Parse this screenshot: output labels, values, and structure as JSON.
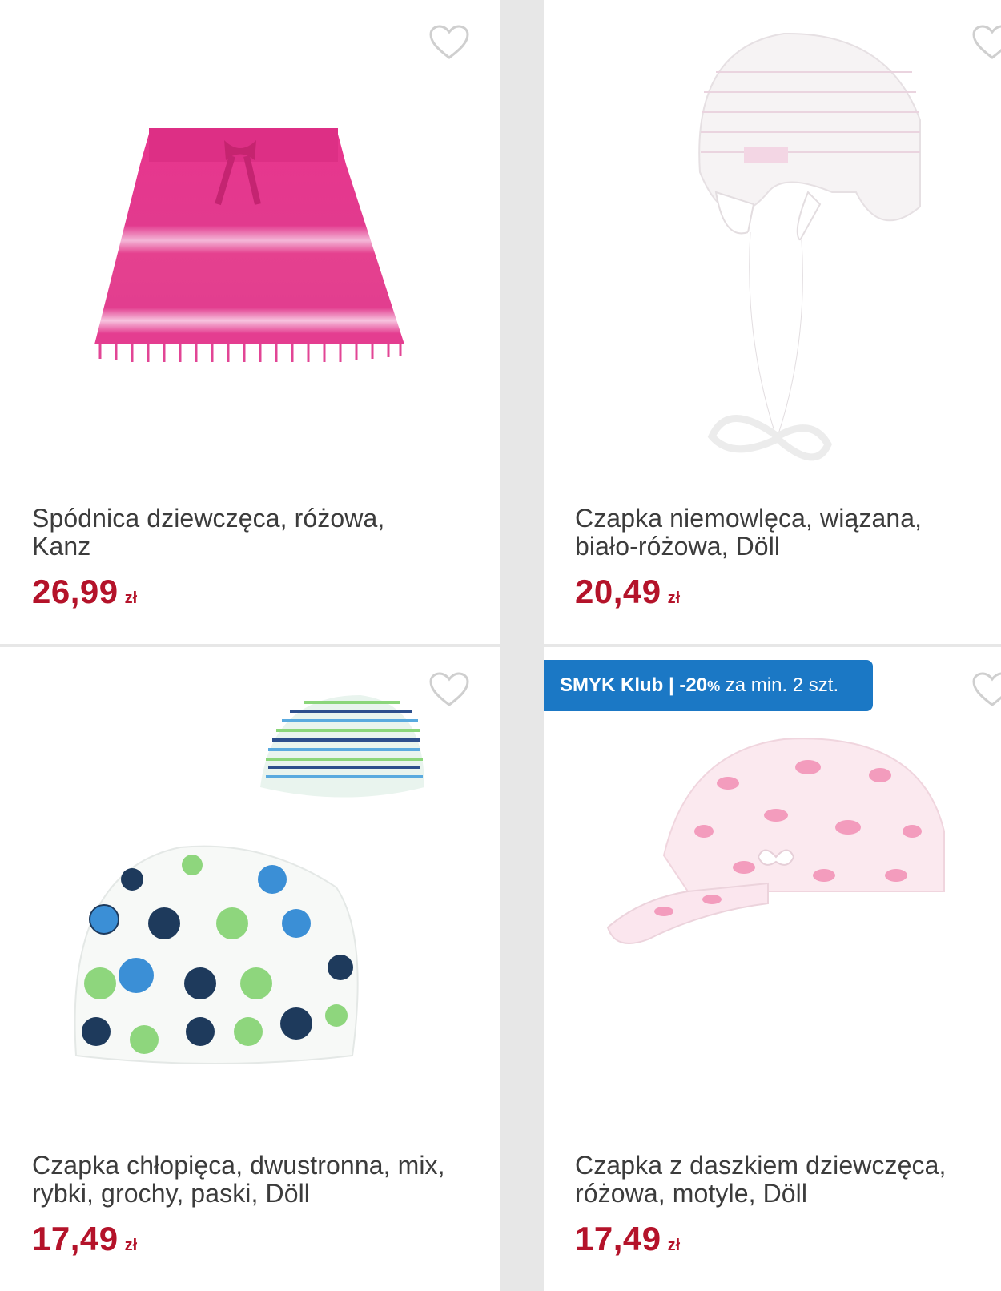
{
  "products": [
    {
      "title": "Spódnica dziewczęca, różowa, Kanz",
      "price": "26,99",
      "currency": "zł",
      "image": "pink-tie-dye-skirt"
    },
    {
      "title": "Czapka niemowlęca, wiązana, biało-różowa, Döll",
      "price": "20,49",
      "currency": "zł",
      "image": "white-baby-hat-with-ties"
    },
    {
      "title": "Czapka chłopięca, dwustronna, mix, rybki, grochy, paski, Döll",
      "price": "17,49",
      "currency": "zł",
      "image": "reversible-fish-dots-hat"
    },
    {
      "title": "Czapka z daszkiem dziewczęca, różowa, motyle, Döll",
      "price": "17,49",
      "currency": "zł",
      "image": "pink-butterfly-cap",
      "promo": {
        "brand": "SMYK Klub",
        "separator": "|",
        "discount": "-20",
        "percent": "%",
        "condition": "za min. 2 szt."
      }
    }
  ],
  "icons": {
    "wishlist": "heart-outline-icon"
  },
  "colors": {
    "price": "#b4132a",
    "promo_bg": "#1b78c5",
    "text": "#3c3c3c"
  }
}
